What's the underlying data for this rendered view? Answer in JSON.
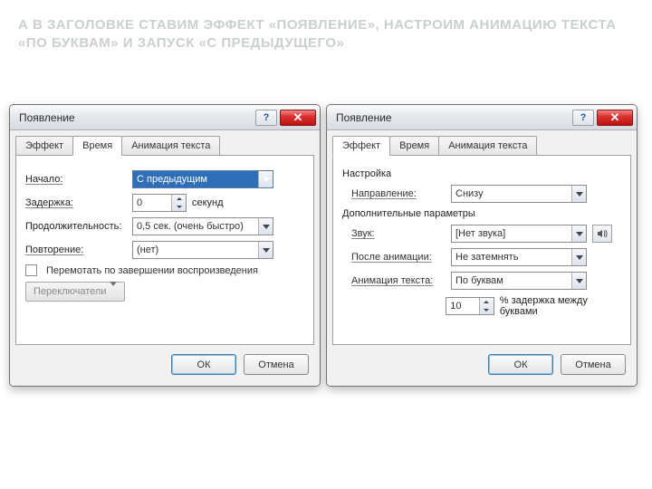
{
  "slide_title": "А В ЗАГОЛОВКЕ СТАВИМ ЭФФЕКТ «ПОЯВЛЕНИЕ», НАСТРОИМ АНИМАЦИЮ ТЕКСТА «ПО БУКВАМ» И ЗАПУСК «С ПРЕДЫДУЩЕГО»",
  "left": {
    "title": "Появление",
    "tabs": {
      "effect": "Эффект",
      "time": "Время",
      "textanim": "Анимация текста"
    },
    "fields": {
      "start_label": "Начало:",
      "start_value": "С предыдущим",
      "delay_label": "Задержка:",
      "delay_value": "0",
      "delay_suffix": "секунд",
      "duration_label": "Продолжительность:",
      "duration_value": "0,5 сек. (очень быстро)",
      "repeat_label": "Повторение:",
      "repeat_value": "(нет)",
      "rewind_label": "Перемотать по завершении воспроизведения",
      "triggers_label": "Переключатели"
    },
    "buttons": {
      "ok": "ОК",
      "cancel": "Отмена"
    }
  },
  "right": {
    "title": "Появление",
    "tabs": {
      "effect": "Эффект",
      "time": "Время",
      "textanim": "Анимация текста"
    },
    "group_setup": "Настройка",
    "group_extra": "Дополнительные параметры",
    "fields": {
      "direction_label": "Направление:",
      "direction_value": "Снизу",
      "sound_label": "Звук:",
      "sound_value": "[Нет звука]",
      "after_label": "После анимации:",
      "after_value": "Не затемнять",
      "textanim_label": "Анимация текста:",
      "textanim_value": "По буквам",
      "percent_value": "10",
      "percent_suffix": "% задержка между буквами"
    },
    "buttons": {
      "ok": "ОК",
      "cancel": "Отмена"
    }
  }
}
